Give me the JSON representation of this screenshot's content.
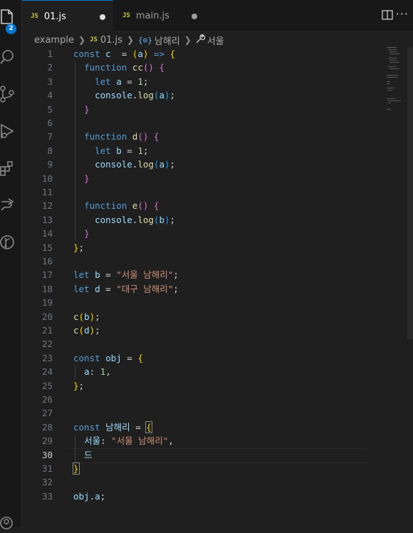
{
  "activity_bar": {
    "badge": "2",
    "icons": [
      "explorer-icon",
      "search-icon",
      "source-control-icon",
      "run-debug-icon",
      "extensions-icon",
      "remote-explorer-icon",
      "git-graph-icon",
      "account-icon"
    ]
  },
  "tabs": [
    {
      "icon": "JS",
      "label": "01.js",
      "modified": true,
      "active": true
    },
    {
      "icon": "JS",
      "label": "main.js",
      "modified": true,
      "active": false
    }
  ],
  "breadcrumb": {
    "folder": "example",
    "file_icon": "JS",
    "file": "01.js",
    "symbol1_icon": "{⊙}",
    "symbol1": "남해리",
    "symbol2_icon": "🔧",
    "symbol2": "서울"
  },
  "editor": {
    "current_line": 30,
    "lines": [
      {
        "no": "1",
        "tokens": [
          [
            "k",
            "const "
          ],
          [
            "v",
            "c"
          ],
          [
            "",
            "  = "
          ],
          [
            "b1",
            "("
          ],
          [
            "v",
            "a"
          ],
          [
            "b1",
            ")"
          ],
          [
            "",
            " "
          ],
          [
            "k",
            "=>"
          ],
          [
            "",
            " "
          ],
          [
            "b1",
            "{"
          ]
        ]
      },
      {
        "no": "2",
        "tokens": [
          [
            "",
            "  "
          ],
          [
            "k",
            "function "
          ],
          [
            "f",
            "cc"
          ],
          [
            "b2",
            "()"
          ],
          [
            "",
            " "
          ],
          [
            "b2",
            "{"
          ]
        ]
      },
      {
        "no": "3",
        "tokens": [
          [
            "",
            "    "
          ],
          [
            "k",
            "let "
          ],
          [
            "v",
            "a"
          ],
          [
            "",
            " = "
          ],
          [
            "n",
            "1"
          ],
          [
            "",
            ";"
          ]
        ]
      },
      {
        "no": "4",
        "tokens": [
          [
            "",
            "    "
          ],
          [
            "v",
            "console"
          ],
          [
            "",
            "."
          ],
          [
            "f",
            "log"
          ],
          [
            "b3",
            "("
          ],
          [
            "v",
            "a"
          ],
          [
            "b3",
            ")"
          ],
          [
            "",
            ";"
          ]
        ]
      },
      {
        "no": "5",
        "tokens": [
          [
            "",
            "  "
          ],
          [
            "b2",
            "}"
          ]
        ]
      },
      {
        "no": "6",
        "tokens": []
      },
      {
        "no": "7",
        "tokens": [
          [
            "",
            "  "
          ],
          [
            "k",
            "function "
          ],
          [
            "f",
            "d"
          ],
          [
            "b2",
            "()"
          ],
          [
            "",
            " "
          ],
          [
            "b2",
            "{"
          ]
        ]
      },
      {
        "no": "8",
        "tokens": [
          [
            "",
            "    "
          ],
          [
            "k",
            "let "
          ],
          [
            "v",
            "b"
          ],
          [
            "",
            " = "
          ],
          [
            "n",
            "1"
          ],
          [
            "",
            ";"
          ]
        ]
      },
      {
        "no": "9",
        "tokens": [
          [
            "",
            "    "
          ],
          [
            "v",
            "console"
          ],
          [
            "",
            "."
          ],
          [
            "f",
            "log"
          ],
          [
            "b3",
            "("
          ],
          [
            "v",
            "a"
          ],
          [
            "b3",
            ")"
          ],
          [
            "",
            ";"
          ]
        ]
      },
      {
        "no": "10",
        "tokens": [
          [
            "",
            "  "
          ],
          [
            "b2",
            "}"
          ]
        ]
      },
      {
        "no": "11",
        "tokens": []
      },
      {
        "no": "12",
        "tokens": [
          [
            "",
            "  "
          ],
          [
            "k",
            "function "
          ],
          [
            "f",
            "e"
          ],
          [
            "b2",
            "()"
          ],
          [
            "",
            " "
          ],
          [
            "b2",
            "{"
          ]
        ]
      },
      {
        "no": "13",
        "tokens": [
          [
            "",
            "    "
          ],
          [
            "v",
            "console"
          ],
          [
            "",
            "."
          ],
          [
            "f",
            "log"
          ],
          [
            "b3",
            "("
          ],
          [
            "v",
            "b"
          ],
          [
            "b3",
            ")"
          ],
          [
            "",
            ";"
          ]
        ]
      },
      {
        "no": "14",
        "tokens": [
          [
            "",
            "  "
          ],
          [
            "b2",
            "}"
          ]
        ]
      },
      {
        "no": "15",
        "tokens": [
          [
            "b1",
            "}"
          ],
          [
            "",
            ";"
          ]
        ]
      },
      {
        "no": "16",
        "tokens": []
      },
      {
        "no": "17",
        "tokens": [
          [
            "k",
            "let "
          ],
          [
            "v",
            "b"
          ],
          [
            "",
            " = "
          ],
          [
            "s",
            "\"서울 남해리\""
          ],
          [
            "",
            ";"
          ]
        ]
      },
      {
        "no": "18",
        "tokens": [
          [
            "k",
            "let "
          ],
          [
            "v",
            "d"
          ],
          [
            "",
            " = "
          ],
          [
            "s",
            "\"대구 남해리\""
          ],
          [
            "",
            ";"
          ]
        ]
      },
      {
        "no": "19",
        "tokens": []
      },
      {
        "no": "20",
        "tokens": [
          [
            "f",
            "c"
          ],
          [
            "b1",
            "("
          ],
          [
            "v",
            "b"
          ],
          [
            "b1",
            ")"
          ],
          [
            "",
            ";"
          ]
        ]
      },
      {
        "no": "21",
        "tokens": [
          [
            "f",
            "c"
          ],
          [
            "b1",
            "("
          ],
          [
            "v",
            "d"
          ],
          [
            "b1",
            ")"
          ],
          [
            "",
            ";"
          ]
        ]
      },
      {
        "no": "22",
        "tokens": []
      },
      {
        "no": "23",
        "tokens": [
          [
            "k",
            "const "
          ],
          [
            "v",
            "obj"
          ],
          [
            "",
            " = "
          ],
          [
            "b1",
            "{"
          ]
        ]
      },
      {
        "no": "24",
        "tokens": [
          [
            "",
            "  "
          ],
          [
            "v",
            "a"
          ],
          [
            "",
            ": "
          ],
          [
            "n",
            "1"
          ],
          [
            "",
            ","
          ]
        ]
      },
      {
        "no": "25",
        "tokens": [
          [
            "b1",
            "}"
          ],
          [
            "",
            ";"
          ]
        ]
      },
      {
        "no": "26",
        "tokens": []
      },
      {
        "no": "27",
        "tokens": []
      },
      {
        "no": "28",
        "tokens": [
          [
            "k",
            "const "
          ],
          [
            "v",
            "남해리"
          ],
          [
            "",
            " = "
          ],
          [
            "b1",
            "{"
          ]
        ]
      },
      {
        "no": "29",
        "tokens": [
          [
            "",
            "  "
          ],
          [
            "v",
            "서울"
          ],
          [
            "",
            ": "
          ],
          [
            "s",
            "\"서울 남해리\""
          ],
          [
            "",
            ","
          ]
        ]
      },
      {
        "no": "30",
        "tokens": [
          [
            "",
            "  "
          ],
          [
            "v",
            "드"
          ]
        ]
      },
      {
        "no": "31",
        "tokens": [
          [
            "b1",
            "}"
          ]
        ]
      },
      {
        "no": "32",
        "tokens": []
      },
      {
        "no": "33",
        "tokens": [
          [
            "v",
            "obj"
          ],
          [
            "",
            "."
          ],
          [
            "v",
            "a"
          ],
          [
            "",
            ";"
          ]
        ]
      }
    ]
  },
  "colors": {
    "background": "#1f1f1f",
    "keyword": "#569cd6",
    "variable": "#9cdcfe",
    "function": "#dcdcaa",
    "string": "#ce9178",
    "number": "#b5cea8",
    "bracket1": "#ffd700",
    "bracket2": "#da70d6",
    "bracket3": "#179fff",
    "badge": "#0078d4"
  }
}
